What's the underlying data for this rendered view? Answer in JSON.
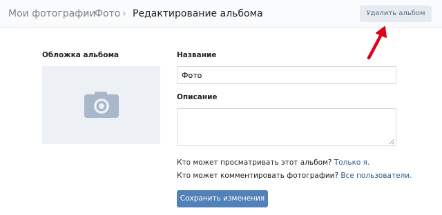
{
  "breadcrumb": {
    "items": [
      "Мои фотографии",
      "Фото"
    ],
    "current": "Редактирование альбома",
    "separator": "›"
  },
  "header": {
    "delete_label": "Удалить альбом"
  },
  "cover": {
    "label": "Обложка альбома",
    "icon": "camera-icon"
  },
  "form": {
    "name_label": "Название",
    "name_value": "Фото",
    "description_label": "Описание",
    "description_value": ""
  },
  "privacy": {
    "view_question": "Кто может просматривать этот альбом?",
    "view_value": "Только я.",
    "comment_question": "Кто может комментировать фотографии?",
    "comment_value": "Все пользователи."
  },
  "actions": {
    "save_label": "Сохранить изменения"
  },
  "colors": {
    "accent": "#5181b8",
    "link": "#2a5885",
    "annotation_arrow": "#e0001a"
  }
}
